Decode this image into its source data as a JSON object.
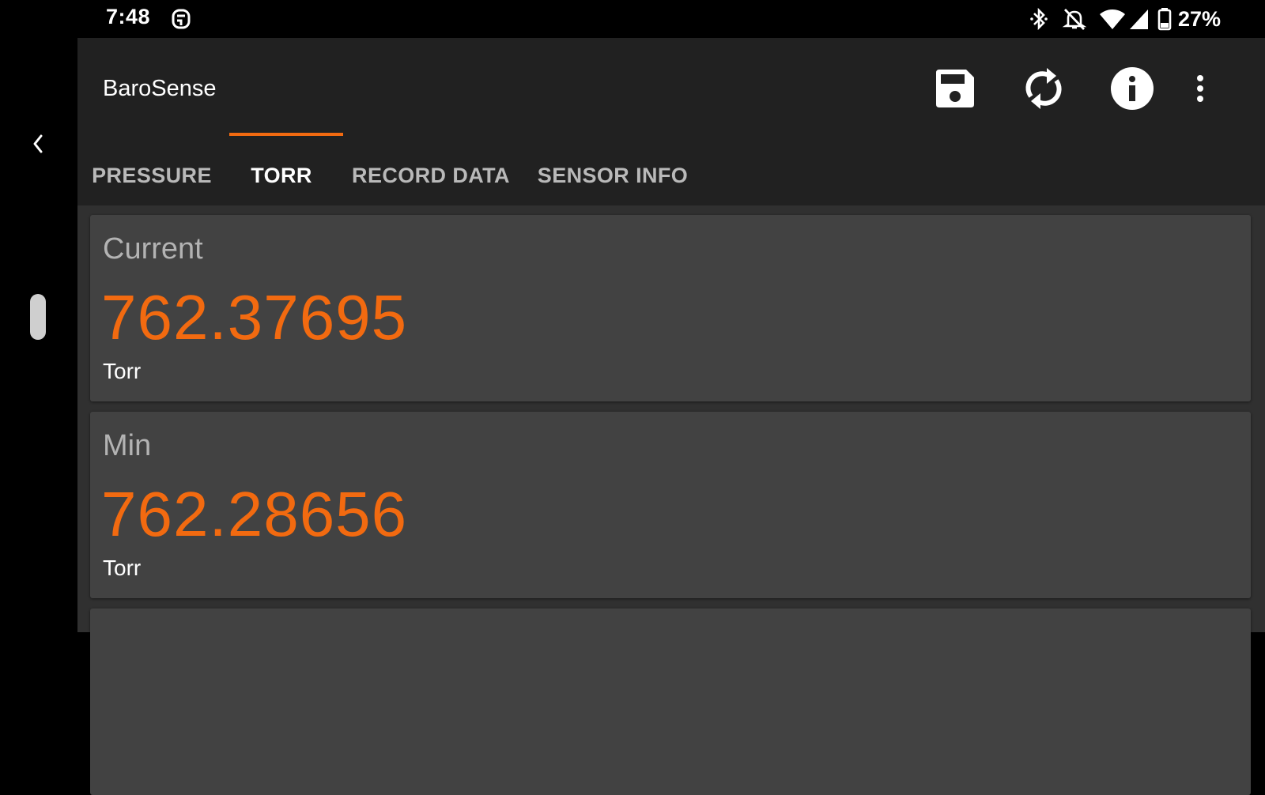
{
  "status_bar": {
    "time": "7:48",
    "battery": "27%",
    "icons": [
      "app-notification-icon",
      "bluetooth-icon",
      "notifications-off-icon",
      "wifi-icon",
      "cell-signal-icon",
      "battery-icon"
    ]
  },
  "app_bar": {
    "title": "BaroSense",
    "actions": [
      "save-icon",
      "refresh-icon",
      "info-icon",
      "overflow-menu-icon"
    ]
  },
  "tabs": [
    {
      "label": "PRESSURE",
      "active": false
    },
    {
      "label": "TORR",
      "active": true
    },
    {
      "label": "RECORD DATA",
      "active": false
    },
    {
      "label": "SENSOR INFO",
      "active": false
    }
  ],
  "cards": [
    {
      "label": "Current",
      "value": "762.37695",
      "unit": "Torr"
    },
    {
      "label": "Min",
      "value": "762.28656",
      "unit": "Torr"
    }
  ],
  "colors": {
    "accent": "#f26a10",
    "app_bar": "#212121",
    "card": "#424242",
    "background": "#303030"
  }
}
